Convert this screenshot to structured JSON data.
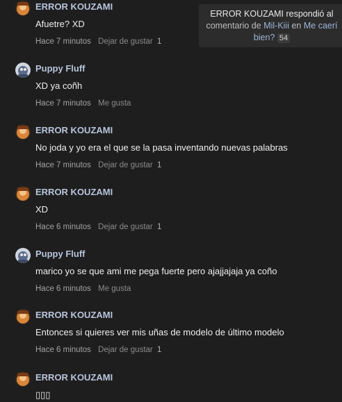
{
  "notification": {
    "user": "ERROR KOUZAMI",
    "verb": "respondió al",
    "line2_prefix": "comentario de",
    "target_user": "Mil-Kiii",
    "preposition": "en",
    "post_title_part1": "Me caerí",
    "post_title_part2": "bien?",
    "count": "54"
  },
  "comments": [
    {
      "author": "ERROR KOUZAMI",
      "avatar": "error-kouzami-avatar",
      "text": "Afuetre? XD",
      "time": "Hace 7 minutos",
      "action": "Dejar de gustar",
      "likes": "1"
    },
    {
      "author": "Puppy Fluff",
      "avatar": "puppy-fluff-avatar",
      "text": "XD ya coñh",
      "time": "Hace 7 minutos",
      "action": "Me gusta",
      "likes": ""
    },
    {
      "author": "ERROR KOUZAMI",
      "avatar": "error-kouzami-avatar",
      "text": "No joda y yo era el que se la pasa inventando nuevas palabras",
      "time": "Hace 7 minutos",
      "action": "Dejar de gustar",
      "likes": "1"
    },
    {
      "author": "ERROR KOUZAMI",
      "avatar": "error-kouzami-avatar",
      "text": "XD",
      "time": "Hace 6 minutos",
      "action": "Dejar de gustar",
      "likes": "1"
    },
    {
      "author": "Puppy Fluff",
      "avatar": "puppy-fluff-avatar",
      "text": "marico yo se que ami me pega fuerte pero ajajjajaja ya coño",
      "time": "Hace 6 minutos",
      "action": "Me gusta",
      "likes": ""
    },
    {
      "author": "ERROR KOUZAMI",
      "avatar": "error-kouzami-avatar",
      "text": "Entonces si quieres ver mis uñas de modelo de último modelo",
      "time": "Hace 6 minutos",
      "action": "Dejar de gustar",
      "likes": "1"
    },
    {
      "author": "ERROR KOUZAMI",
      "avatar": "error-kouzami-avatar",
      "text": "▯▯▯",
      "time": "",
      "action": "",
      "likes": ""
    }
  ],
  "colors": {
    "background": "#1e1e1e",
    "author": "#b8c4dc",
    "meta": "#8b8b8b"
  }
}
